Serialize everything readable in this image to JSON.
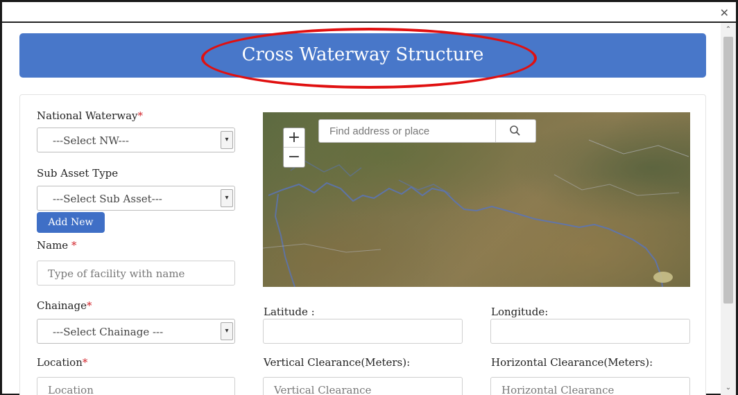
{
  "window": {
    "close_glyph": "✕"
  },
  "scrollbar": {
    "up_glyph": "⌃",
    "down_glyph": "⌄"
  },
  "header": {
    "title": "Cross Waterway Structure"
  },
  "form": {
    "national_waterway": {
      "label": "National Waterway",
      "required_mark": "*",
      "selected": "---Select NW---"
    },
    "sub_asset_type": {
      "label": "Sub Asset Type",
      "selected": "---Select Sub Asset---"
    },
    "add_new_label": "Add New",
    "name": {
      "label": "Name ",
      "required_mark": "*",
      "placeholder": "Type of facility with name"
    },
    "chainage": {
      "label": "Chainage",
      "required_mark": "*",
      "selected": "---Select Chainage ---"
    },
    "latitude": {
      "label": "Latitude :",
      "value": ""
    },
    "longitude": {
      "label": "Longitude:",
      "value": ""
    },
    "location": {
      "label": "Location",
      "required_mark": "*",
      "placeholder": "Location"
    },
    "vertical_clearance": {
      "label": "Vertical Clearance(Meters):",
      "placeholder": "Vertical Clearance"
    },
    "horizontal_clearance": {
      "label": "Horizontal Clearance(Meters):",
      "placeholder": "Horizontal Clearance"
    }
  },
  "map": {
    "zoom_in": "+",
    "zoom_out": "−",
    "search_placeholder": "Find address or place"
  },
  "colors": {
    "header_bg": "#4877c9",
    "button_bg": "#3f6fc6",
    "required": "#d2232a",
    "annotation": "#e01010"
  },
  "icons": [
    "close-icon",
    "search-icon",
    "chevron-down-icon",
    "scroll-up-icon",
    "scroll-down-icon"
  ]
}
